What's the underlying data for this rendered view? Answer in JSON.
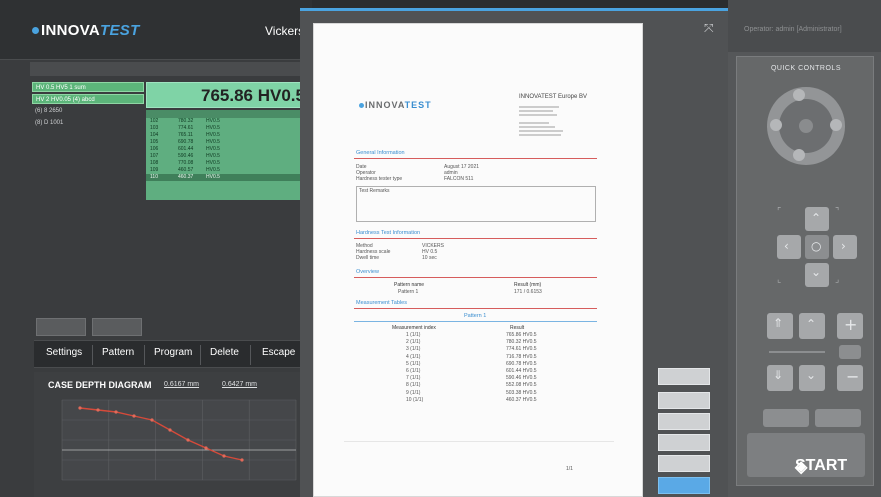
{
  "app": {
    "logo_prefix": "INNOVA",
    "logo_suffix": "TEST",
    "mode": "Vickers"
  },
  "left_list": [
    "HV 0.5 HV5 1 sum",
    "HV 2 HV0.05 (4) abcd",
    "(6) 8 2650",
    "(8) D 1001"
  ],
  "result_value": "765.86 HV0.5",
  "result_table_rows": [
    [
      "102",
      "780.32",
      "HV0.5"
    ],
    [
      "103",
      "774.61",
      "HV0.5"
    ],
    [
      "104",
      "765.11",
      "HV0.5"
    ],
    [
      "105",
      "690.78",
      "HV0.5"
    ],
    [
      "106",
      "601.44",
      "HV0.5"
    ],
    [
      "107",
      "590.46",
      "HV0.5"
    ],
    [
      "108",
      "770.08",
      "HV0.5"
    ],
    [
      "109",
      "460.57",
      "HV0.5"
    ],
    [
      "110",
      "460.37",
      "HV0.5"
    ]
  ],
  "menu": {
    "settings": "Settings",
    "pattern": "Pattern",
    "program": "Program",
    "delete": "Delete",
    "escape": "Escape"
  },
  "chart_data": {
    "type": "line",
    "title": "CASE DEPTH DIAGRAM",
    "readout_1": "0.6167 mm",
    "readout_2": "0.6427 mm",
    "x": [
      0.1,
      0.2,
      0.3,
      0.4,
      0.5,
      0.6,
      0.7,
      0.8,
      0.9,
      1.0
    ],
    "values": [
      760,
      750,
      740,
      720,
      700,
      650,
      600,
      560,
      520,
      500
    ],
    "xlim": [
      0,
      1.3
    ],
    "ylim": [
      400,
      800
    ],
    "grid": true
  },
  "report": {
    "company": "INNOVATEST Europe BV",
    "general": "General Information",
    "date_label": "Date",
    "date_value": "August 17 2021",
    "operator_label": "Operator",
    "operator_value": "admin",
    "tester_label": "Hardness tester type",
    "tester_value": "FALCON 511",
    "remark": "Test Remarks",
    "hardness": "Hardness Test Information",
    "method_label": "Method",
    "method_value": "VICKERS",
    "scale_label": "Hardness scale",
    "scale_value": "HV 0.5",
    "dwell_label": "Dwell time",
    "dwell_value": "10 sec",
    "overview": "Overview",
    "pattern_name_h": "Pattern name",
    "result_h": "Result (mm)",
    "pattern_name": "Pattern 1",
    "result_val": "171 / 0.6153",
    "tables": "Measurement Tables",
    "table_title": "Pattern 1",
    "mi_h": "Measurement index",
    "res_h": "Result",
    "measurements": [
      [
        "1 (1/1)",
        "765.86 HV0.5"
      ],
      [
        "2 (1/1)",
        "780.32 HV0.5"
      ],
      [
        "3 (1/1)",
        "774.61 HV0.5"
      ],
      [
        "4 (1/1)",
        "716.78 HV0.5"
      ],
      [
        "5 (1/1)",
        "690.78 HV0.5"
      ],
      [
        "6 (1/1)",
        "601.44 HV0.5"
      ],
      [
        "7 (1/1)",
        "590.46 HV0.5"
      ],
      [
        "8 (1/1)",
        "552.08 HV0.5"
      ],
      [
        "9 (1/1)",
        "503.38 HV0.5"
      ],
      [
        "10 (1/1)",
        "460.37 HV0.5"
      ]
    ],
    "page": "1/1"
  },
  "right_panel": {
    "user": "Operator: admin   [Administrator]",
    "quick": "QUICK CONTROLS",
    "start": "START"
  }
}
